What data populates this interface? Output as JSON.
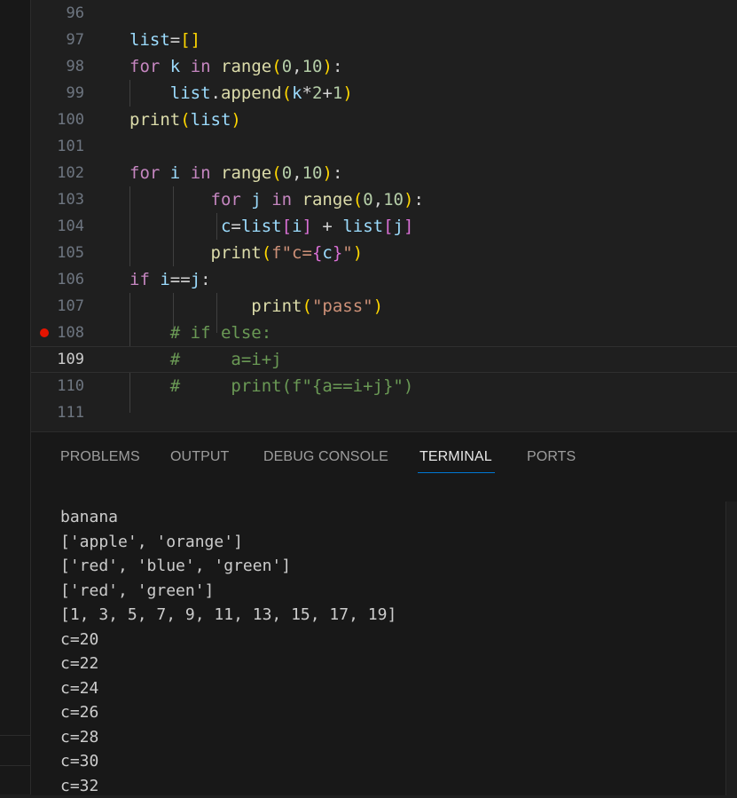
{
  "editor": {
    "lines": [
      {
        "num": "96"
      },
      {
        "num": "97"
      },
      {
        "num": "98"
      },
      {
        "num": "99"
      },
      {
        "num": "100"
      },
      {
        "num": "101"
      },
      {
        "num": "102"
      },
      {
        "num": "103"
      },
      {
        "num": "104"
      },
      {
        "num": "105"
      },
      {
        "num": "106"
      },
      {
        "num": "107"
      },
      {
        "num": "108"
      },
      {
        "num": "109"
      },
      {
        "num": "110"
      },
      {
        "num": "111"
      }
    ],
    "breakpoint_line": "108",
    "current_line": "109"
  },
  "panel": {
    "tabs": [
      {
        "label": "PROBLEMS"
      },
      {
        "label": "OUTPUT"
      },
      {
        "label": "DEBUG CONSOLE"
      },
      {
        "label": "TERMINAL"
      },
      {
        "label": "PORTS"
      }
    ],
    "active_tab": "TERMINAL",
    "terminal_lines": [
      "banana",
      "['apple', 'orange']",
      "['red', 'blue', 'green']",
      "['red', 'green']",
      "[1, 3, 5, 7, 9, 11, 13, 15, 17, 19]",
      "c=20",
      "c=22",
      "c=24",
      "c=26",
      "c=28",
      "c=30",
      "c=32"
    ]
  },
  "colors": {
    "breakpoint": "#e51400",
    "active_tab_underline": "#0078d4"
  }
}
